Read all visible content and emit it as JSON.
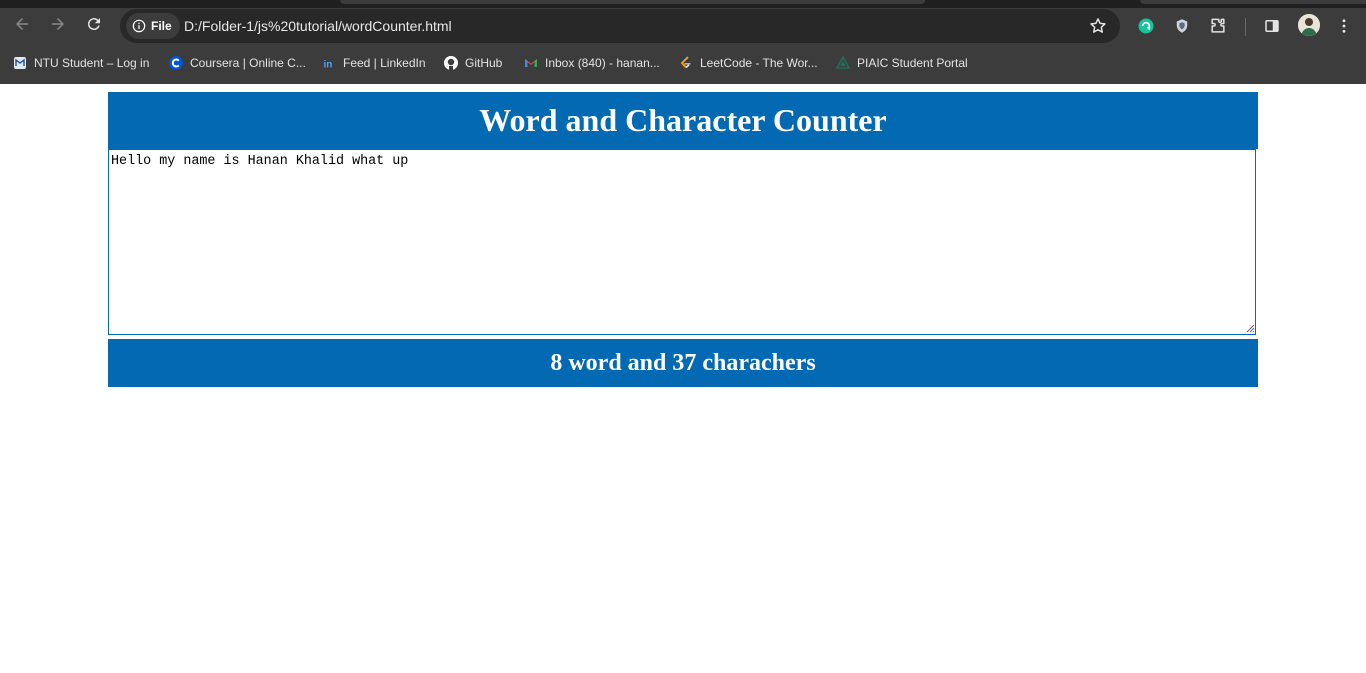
{
  "browser": {
    "url_chip": "File",
    "url": "D:/Folder-1/js%20tutorial/wordCounter.html",
    "nav": [
      "back-icon",
      "forward-icon",
      "reload-icon"
    ],
    "extensions": [
      "grammarly-icon",
      "shield-extension-icon",
      "puzzle-extensions-icon",
      "side-panel-icon",
      "profile-avatar",
      "kebab-menu-icon"
    ],
    "bookmarks": [
      {
        "label": "NTU Student – Log in",
        "icon": "ntu-logo-icon"
      },
      {
        "label": "Coursera | Online C...",
        "icon": "coursera-icon"
      },
      {
        "label": "Feed | LinkedIn",
        "icon": "linkedin-icon"
      },
      {
        "label": "GitHub",
        "icon": "github-icon"
      },
      {
        "label": "Inbox (840) - hanan...",
        "icon": "gmail-icon"
      },
      {
        "label": "LeetCode - The Wor...",
        "icon": "leetcode-icon"
      },
      {
        "label": "PIAIC Student Portal",
        "icon": "piaic-icon"
      }
    ]
  },
  "page": {
    "title": "Word and Character Counter",
    "textarea_value": "Hello my name is Hanan Khalid what up",
    "result": "8 word and 37 charachers"
  },
  "colors": {
    "accent": "#0269b2",
    "chrome": "#3c3c3c",
    "omnibox": "#282828"
  }
}
